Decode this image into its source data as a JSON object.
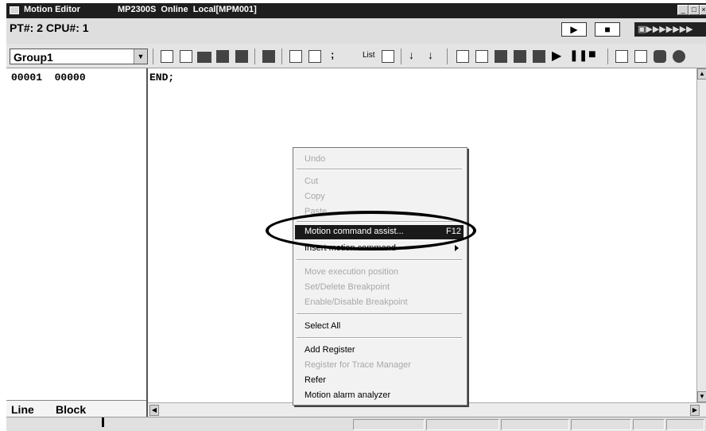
{
  "window": {
    "title": "Motion Editor",
    "subtitle": "MP2300S  Online  Local[MPM001]",
    "controls": [
      "_",
      "□",
      "×"
    ]
  },
  "status_row": {
    "text": "PT#: 2 CPU#: 1",
    "run_symbol": "▶",
    "stop_symbol": "■",
    "indicator": "▣▶▶▶▶▶▶▶"
  },
  "toolbar": {
    "group_value": "Group1",
    "list_label": "List"
  },
  "left_pane": {
    "line_number": "00001",
    "block_number": "00000",
    "tab_line": "Line",
    "tab_block": "Block"
  },
  "editor": {
    "text": "END;"
  },
  "context_menu": {
    "undo": "Undo",
    "cut": "Cut",
    "copy": "Copy",
    "paste": "Paste",
    "motion_assist": "Motion command assist...",
    "motion_assist_key": "F12",
    "insert_motion": "Insert motion command",
    "move_exec": "Move execution position",
    "set_breakpoint": "Set/Delete Breakpoint",
    "enable_breakpoint": "Enable/Disable Breakpoint",
    "select_all": "Select All",
    "add_register": "Add Register",
    "register_trace": "Register for Trace Manager",
    "refer": "Refer",
    "alarm_analyzer": "Motion alarm analyzer"
  },
  "colors": {
    "title_bar": "#1e1e1e",
    "menu_highlight": "#1a1a1a",
    "disabled_text": "#a8a8a8"
  },
  "icons": [
    "new-file-icon",
    "copy-icon",
    "open-folder-icon",
    "save-icon",
    "save-all-icon",
    "print-icon",
    "compile-icon",
    "comment-icon",
    "list-icon",
    "table-icon",
    "step-icon",
    "down-arrow-icon",
    "run-icon",
    "pause-icon",
    "stop-icon"
  ]
}
